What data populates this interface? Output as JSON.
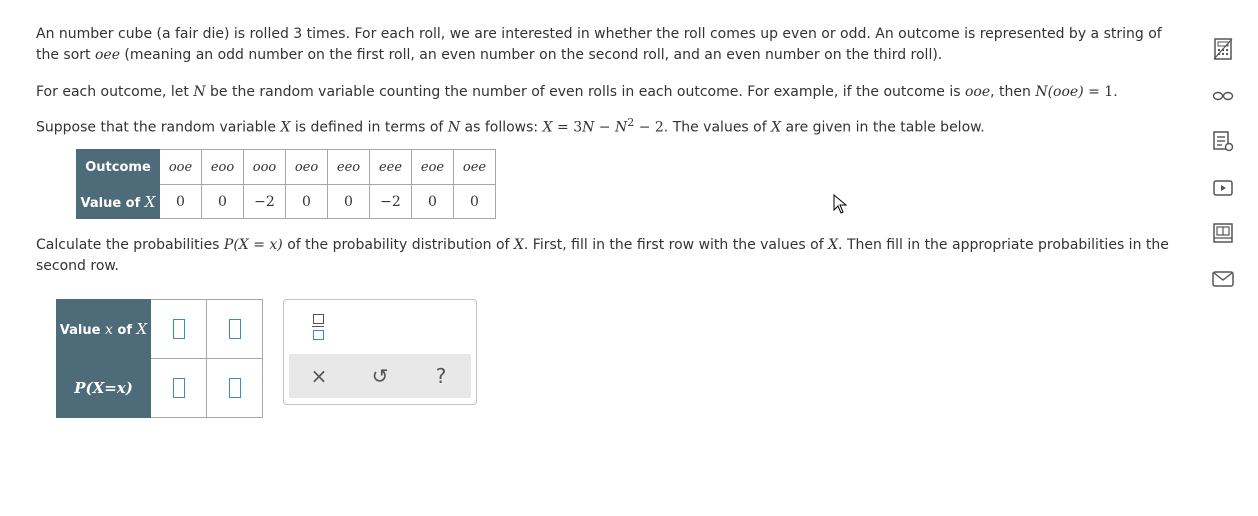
{
  "problem": {
    "p1_a": "An number cube (a fair die) is rolled 3 times. For each roll, we are interested in whether the roll comes up even or odd. An outcome is represented by a string of the sort ",
    "p1_m": "oee",
    "p1_b": " (meaning an odd number on the first roll, an even number on the second roll, and an even number on the third roll).",
    "p2_a": "For each outcome, let ",
    "p2_m1": "N",
    "p2_b": " be the random variable counting the number of even rolls in each outcome. For example, if the outcome is ",
    "p2_m2": "ooe",
    "p2_c": ", then ",
    "p2_m3": "N",
    "p2_m4": "(ooe)",
    "p2_d": " = 1.",
    "p3_a": "Suppose that the random variable ",
    "p3_m1": "X",
    "p3_b": " is defined in terms of ",
    "p3_m2": "N",
    "p3_c": " as follows: ",
    "p3_f1": "X",
    "p3_f2": " = 3",
    "p3_f3": "N",
    "p3_f4": " − ",
    "p3_f5": "N",
    "p3_sup": "2",
    "p3_f6": " − 2",
    "p3_d": ". The values of ",
    "p3_m3": "X",
    "p3_e": " are given in the table below.",
    "p4_a": "Calculate the probabilities ",
    "p4_m1": "P",
    "p4_m2": "(X = x)",
    "p4_b": " of the probability distribution of ",
    "p4_m3": "X",
    "p4_c": ". First, fill in the first row with the values of ",
    "p4_m4": "X",
    "p4_d": ". Then fill in the appropriate probabilities in the second row."
  },
  "outcome_table": {
    "row1_header": "Outcome",
    "row2_header_text": "Value of ",
    "row2_header_var": "X",
    "outcomes": [
      "ooe",
      "eoo",
      "ooo",
      "oeo",
      "eeo",
      "eee",
      "eoe",
      "oee"
    ],
    "values": [
      "0",
      "0",
      "−2",
      "0",
      "0",
      "−2",
      "0",
      "0"
    ]
  },
  "answer_table": {
    "row1_header_text": "Value ",
    "row1_header_var": "x",
    "row1_header_text2": " of ",
    "row1_header_var2": "X",
    "row2_header": "P(X=x)"
  },
  "toolbar": {
    "clear_icon": "×",
    "undo_icon": "↺",
    "help_icon": "?"
  },
  "colors": {
    "header_bg": "#4e6b7a",
    "input_border": "#3a8bc8",
    "toolbar_bg": "#e8e8e8"
  },
  "side_rail_icons": [
    "calculator-icon",
    "infinity-icon",
    "notes-icon",
    "video-icon",
    "textbook-icon",
    "message-icon"
  ]
}
